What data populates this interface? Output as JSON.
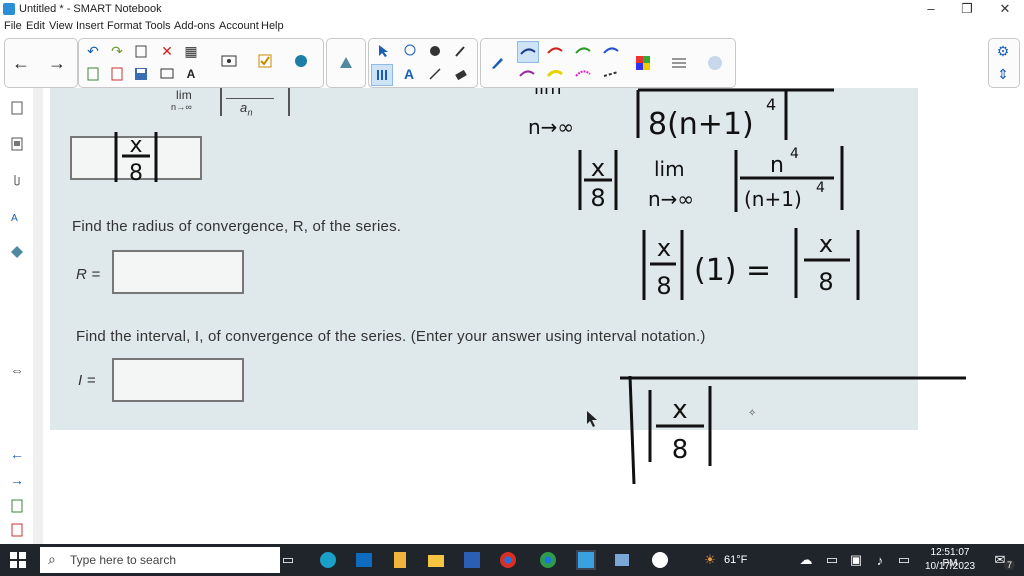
{
  "window": {
    "title": "Untitled * - SMART Notebook"
  },
  "menu": [
    "File",
    "Edit",
    "View",
    "Insert",
    "Format",
    "Tools",
    "Add-ons",
    "Account",
    "Help"
  ],
  "window_controls": {
    "minimize": "–",
    "restore": "❐",
    "close": "✕"
  },
  "toolbar": {
    "back": "←",
    "forward": "→",
    "undo": "↶",
    "redo": "↷",
    "delete": "✕",
    "table": "▦",
    "text": "A"
  },
  "worksheet": {
    "limit_fragment": "lim",
    "limit_sub": "n→∞",
    "denominator": "a",
    "denominator_sub": "n",
    "entered_fraction": {
      "num": "x",
      "den": "8"
    },
    "radius_prompt": "Find the radius of convergence, R, of the series.",
    "radius_label": "R =",
    "interval_prompt": "Find the interval, I, of convergence of the series. (Enter your answer using interval notation.)",
    "interval_label": "I ="
  },
  "handwriting": {
    "line1_lim": "lim",
    "line1_sub": "n→∞",
    "line1_expr": "8(n+1)",
    "line1_pow": "4",
    "line2_num": "x",
    "line2_den": "8",
    "line2_lim": "lim",
    "line2_sub": "n→∞",
    "line2_frac_num": "n",
    "line2_frac_pow": "4",
    "line2_frac_den": "(n+1)",
    "line2_frac_den_pow": "4",
    "line3_left_num": "x",
    "line3_left_den": "8",
    "line3_mid": "(1) =",
    "line3_right_num": "x",
    "line3_right_den": "8",
    "box_num": "x",
    "box_den": "8"
  },
  "taskbar": {
    "search_placeholder": "Type here to search",
    "weather": "61°F",
    "time": "12:51:07 PM",
    "date": "10/17/2023",
    "notifications": "7"
  }
}
